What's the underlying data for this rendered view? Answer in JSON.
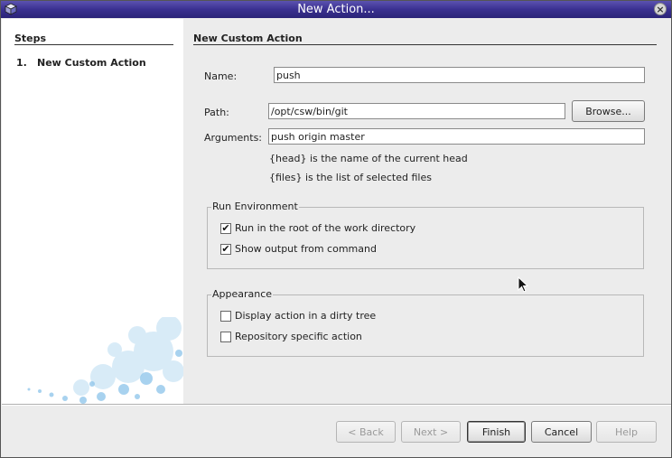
{
  "window": {
    "title": "New Action..."
  },
  "icons": {
    "app": "cube-icon",
    "close": "close-icon",
    "cursor": "mouse-pointer-icon"
  },
  "sidebar": {
    "title": "Steps",
    "steps": [
      {
        "number": "1.",
        "label": "New Custom Action"
      }
    ]
  },
  "panel": {
    "title": "New Custom Action",
    "name_label": "Name:",
    "name_value": "push",
    "path_label": "Path:",
    "path_value": "/opt/csw/bin/git",
    "browse_label": "Browse...",
    "arguments_label": "Arguments:",
    "arguments_value": "push origin master",
    "hint_head": "{head} is the name of the current head",
    "hint_files": "{files} is the list of selected files",
    "run_environment": {
      "legend": "Run Environment",
      "options": [
        {
          "label": "Run in the root of the work directory",
          "checked": true
        },
        {
          "label": "Show output from command",
          "checked": true
        }
      ]
    },
    "appearance": {
      "legend": "Appearance",
      "options": [
        {
          "label": "Display action in a dirty tree",
          "checked": false
        },
        {
          "label": "Repository specific action",
          "checked": false
        }
      ]
    }
  },
  "buttons": {
    "back": "< Back",
    "next": "Next >",
    "finish": "Finish",
    "cancel": "Cancel",
    "help": "Help"
  },
  "colors": {
    "titlebar": "#3a3090",
    "window_bg": "#ececec",
    "sidebar_bg": "#ffffff"
  }
}
